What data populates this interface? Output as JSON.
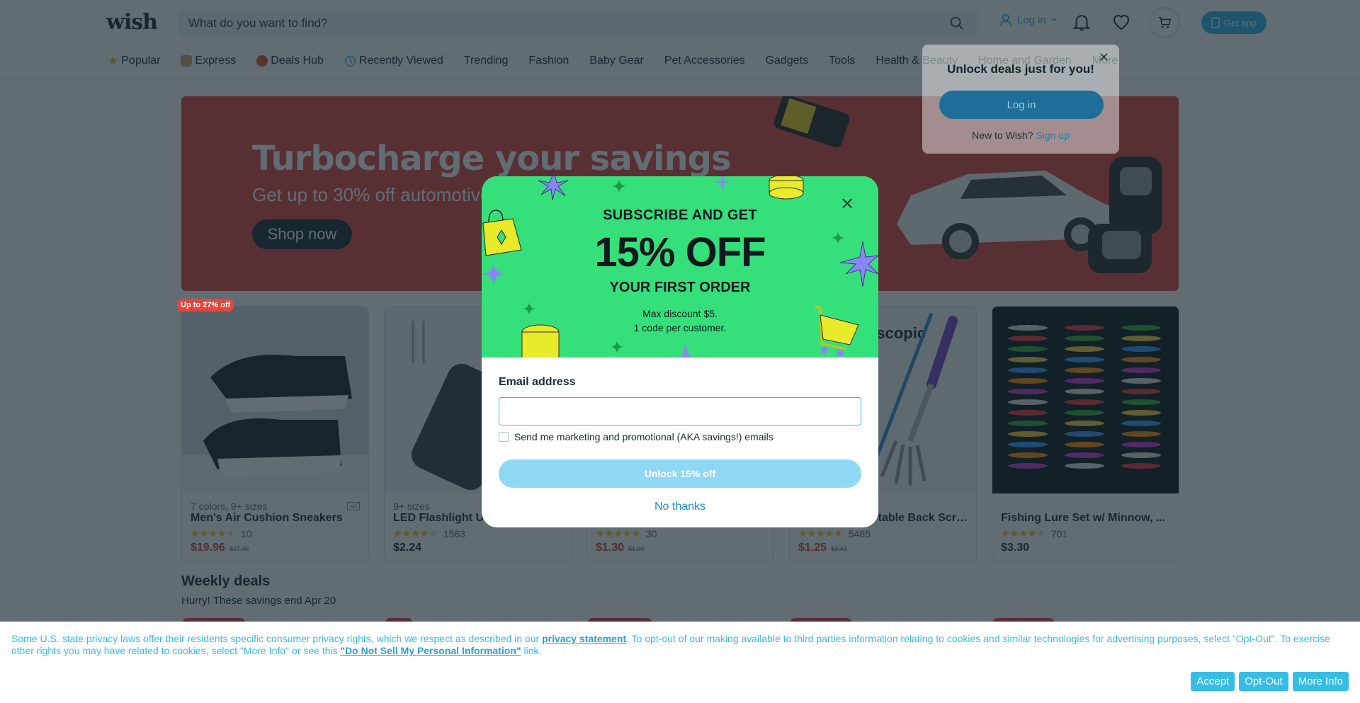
{
  "header": {
    "logo": "wish",
    "search_placeholder": "What do you want to find?",
    "login_label": "Log in",
    "get_app_label": "Get app",
    "icons": [
      "search-icon",
      "user-icon",
      "chevron-down-icon",
      "bell-icon",
      "heart-icon",
      "cart-icon",
      "phone-icon"
    ]
  },
  "nav": [
    {
      "label": "Popular",
      "icon": "star-icon"
    },
    {
      "label": "Express",
      "icon": "truck-icon"
    },
    {
      "label": "Deals Hub",
      "icon": "tag-icon"
    },
    {
      "label": "Recently Viewed",
      "icon": "clock-icon"
    },
    {
      "label": "Trending"
    },
    {
      "label": "Fashion"
    },
    {
      "label": "Baby Gear"
    },
    {
      "label": "Pet Accessories"
    },
    {
      "label": "Gadgets"
    },
    {
      "label": "Tools"
    },
    {
      "label": "Health & Beauty"
    },
    {
      "label": "Home and Garden"
    },
    {
      "label": "More"
    }
  ],
  "login_popover": {
    "title": "Unlock deals just for you!",
    "login_button": "Log in",
    "new_text": "New to Wish?",
    "signup_link": "Sign up"
  },
  "banner": {
    "title": "Turbocharge your savings",
    "subtitle": "Get up to 30% off automotive",
    "button": "Shop now",
    "color": "#e4463c"
  },
  "products": [
    {
      "badge": "Up to 27% off",
      "meta": "7 colors, 9+ sizes",
      "name": "Men's Air Cushion Sneakers",
      "rating": 4,
      "reviews": "10",
      "price": "$19.96",
      "was": "$27.46",
      "sale": true,
      "ad": "ad"
    },
    {
      "meta": "9+ sizes",
      "name": "LED Flashlight USB Rechargeable",
      "rating": 4,
      "reviews": "1563",
      "price": "$2.24",
      "sale": false
    },
    {
      "meta": "",
      "name": "",
      "rating": 4.5,
      "reviews": "30",
      "price": "$1.30",
      "was": "$1.60",
      "sale": true
    },
    {
      "meta": "",
      "name": "Telescopic Portable Back Scratcher",
      "rating": 4.5,
      "reviews": "5465",
      "price": "$1.25",
      "was": "$3.43",
      "sale": true
    },
    {
      "meta": "",
      "name": "Fishing Lure Set w/ Minnow, ...",
      "rating": 4,
      "reviews": "701",
      "price": "$3.30",
      "sale": false
    }
  ],
  "weekly": {
    "title": "Weekly deals",
    "subtitle": "Hurry! These savings end Apr 20"
  },
  "modal": {
    "line1": "SUBSCRIBE AND GET",
    "big": "15% OFF",
    "line2": "YOUR FIRST ORDER",
    "note1": "Max discount $5.",
    "note2": "1 code per customer.",
    "email_label": "Email address",
    "email_value": "",
    "checkbox_label": "Send me marketing and promotional (AKA savings!) emails",
    "checkbox_checked": false,
    "unlock_button": "Unlock 15% off",
    "no_thanks": "No thanks",
    "top_color": "#35e07a"
  },
  "cookie": {
    "text1": "Some U.S. state privacy laws offer their residents specific consumer privacy rights, which we respect as described in our ",
    "link1": "privacy statement",
    "text2": ". To opt-out of our making available to third parties information relating to cookies and similar technologies for advertising purposes, select \"Opt-Out\". To exercise other rights you may have related to cookies, select \"More Info\" or see this ",
    "link2": "\"Do Not Sell My Personal Information\"",
    "text3": " link.",
    "accept": "Accept",
    "opt_out": "Opt-Out",
    "more_info": "More Info"
  }
}
